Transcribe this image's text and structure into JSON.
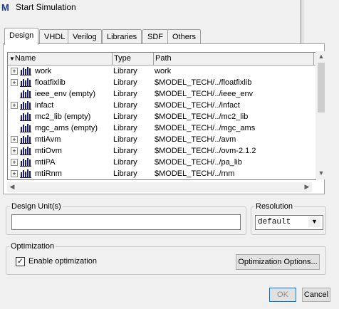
{
  "window": {
    "title": "Start Simulation",
    "app_icon_letter": "M"
  },
  "tabs": [
    {
      "label": "Design",
      "active": true
    },
    {
      "label": "VHDL",
      "active": false
    },
    {
      "label": "Verilog",
      "active": false
    },
    {
      "label": "Libraries",
      "active": false
    },
    {
      "label": "SDF",
      "active": false
    },
    {
      "label": "Others",
      "active": false
    }
  ],
  "library_list": {
    "columns": {
      "name": "Name",
      "type": "Type",
      "path": "Path"
    },
    "rows": [
      {
        "name": "work",
        "type": "Library",
        "path": "work",
        "expandable": true
      },
      {
        "name": "floatfixlib",
        "type": "Library",
        "path": "$MODEL_TECH/../floatfixlib",
        "expandable": true
      },
      {
        "name": "ieee_env  (empty)",
        "type": "Library",
        "path": "$MODEL_TECH/../ieee_env",
        "expandable": false
      },
      {
        "name": "infact",
        "type": "Library",
        "path": "$MODEL_TECH/../infact",
        "expandable": true
      },
      {
        "name": "mc2_lib  (empty)",
        "type": "Library",
        "path": "$MODEL_TECH/../mc2_lib",
        "expandable": false
      },
      {
        "name": "mgc_ams  (empty)",
        "type": "Library",
        "path": "$MODEL_TECH/../mgc_ams",
        "expandable": false
      },
      {
        "name": "mtiAvm",
        "type": "Library",
        "path": "$MODEL_TECH/../avm",
        "expandable": true
      },
      {
        "name": "mtiOvm",
        "type": "Library",
        "path": "$MODEL_TECH/../ovm-2.1.2",
        "expandable": true
      },
      {
        "name": "mtiPA",
        "type": "Library",
        "path": "$MODEL_TECH/../pa_lib",
        "expandable": true
      },
      {
        "name": "mtiRnm",
        "type": "Library",
        "path": "$MODEL_TECH/../rnm",
        "expandable": true
      }
    ]
  },
  "design_unit": {
    "label": "Design Unit(s)",
    "value": ""
  },
  "resolution": {
    "label": "Resolution",
    "selected": "default"
  },
  "optimization": {
    "label": "Optimization",
    "enable_label": "Enable optimization",
    "enabled": true,
    "options_button": "Optimization Options..."
  },
  "buttons": {
    "ok": "OK",
    "cancel": "Cancel"
  },
  "colors": {
    "library_icon": "#1a1a6e",
    "accent": "#0078d7"
  }
}
